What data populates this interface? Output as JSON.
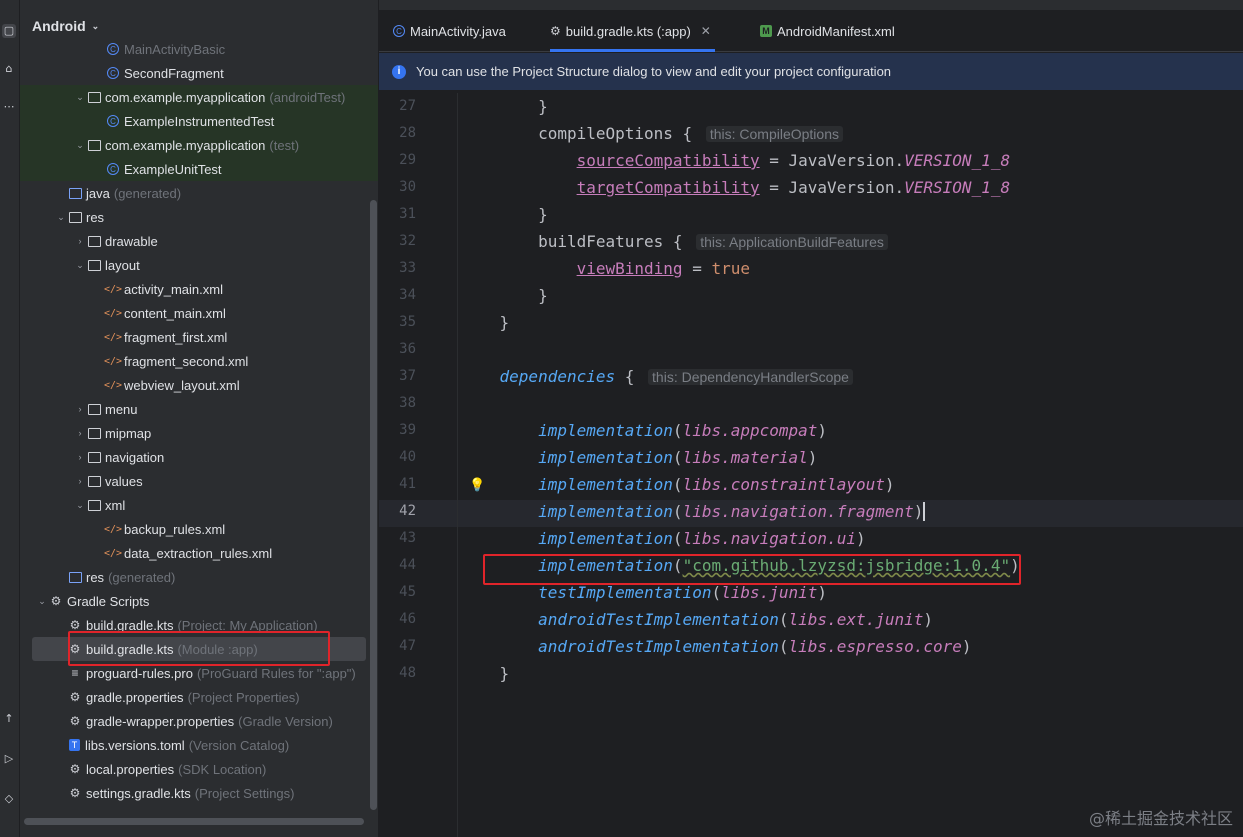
{
  "project_panel": {
    "title": "Android",
    "tree": [
      {
        "label": "MainActivityBasic",
        "hint": "",
        "icon": "class",
        "indent": 3,
        "arrow": ""
      },
      {
        "label": "SecondFragment",
        "hint": "",
        "icon": "class",
        "indent": 3,
        "arrow": ""
      },
      {
        "label": "com.example.myapplication",
        "hint": "(androidTest)",
        "icon": "package",
        "indent": 2,
        "arrow": "down"
      },
      {
        "label": "ExampleInstrumentedTest",
        "hint": "",
        "icon": "class",
        "indent": 3,
        "arrow": ""
      },
      {
        "label": "com.example.myapplication",
        "hint": "(test)",
        "icon": "package",
        "indent": 2,
        "arrow": "down"
      },
      {
        "label": "ExampleUnitTest",
        "hint": "",
        "icon": "class",
        "indent": 3,
        "arrow": ""
      },
      {
        "label": "java",
        "hint": "(generated)",
        "icon": "srcfolder",
        "indent": 1,
        "arrow": ""
      },
      {
        "label": "res",
        "hint": "",
        "icon": "folder",
        "indent": 1,
        "arrow": "down"
      },
      {
        "label": "drawable",
        "hint": "",
        "icon": "folder",
        "indent": 2,
        "arrow": "right"
      },
      {
        "label": "layout",
        "hint": "",
        "icon": "folder",
        "indent": 2,
        "arrow": "down"
      },
      {
        "label": "activity_main.xml",
        "hint": "",
        "icon": "xml",
        "indent": 3,
        "arrow": ""
      },
      {
        "label": "content_main.xml",
        "hint": "",
        "icon": "xml",
        "indent": 3,
        "arrow": ""
      },
      {
        "label": "fragment_first.xml",
        "hint": "",
        "icon": "xml",
        "indent": 3,
        "arrow": ""
      },
      {
        "label": "fragment_second.xml",
        "hint": "",
        "icon": "xml",
        "indent": 3,
        "arrow": ""
      },
      {
        "label": "webview_layout.xml",
        "hint": "",
        "icon": "xml",
        "indent": 3,
        "arrow": ""
      },
      {
        "label": "menu",
        "hint": "",
        "icon": "folder",
        "indent": 2,
        "arrow": "right"
      },
      {
        "label": "mipmap",
        "hint": "",
        "icon": "folder",
        "indent": 2,
        "arrow": "right"
      },
      {
        "label": "navigation",
        "hint": "",
        "icon": "folder",
        "indent": 2,
        "arrow": "right"
      },
      {
        "label": "values",
        "hint": "",
        "icon": "folder",
        "indent": 2,
        "arrow": "right"
      },
      {
        "label": "xml",
        "hint": "",
        "icon": "folder",
        "indent": 2,
        "arrow": "down"
      },
      {
        "label": "backup_rules.xml",
        "hint": "",
        "icon": "xml",
        "indent": 3,
        "arrow": ""
      },
      {
        "label": "data_extraction_rules.xml",
        "hint": "",
        "icon": "xml",
        "indent": 3,
        "arrow": ""
      },
      {
        "label": "res",
        "hint": "(generated)",
        "icon": "srcfolder",
        "indent": 1,
        "arrow": ""
      },
      {
        "label": "Gradle Scripts",
        "hint": "",
        "icon": "gradle",
        "indent": 0,
        "arrow": "down"
      },
      {
        "label": "build.gradle.kts",
        "hint": "(Project: My Application)",
        "icon": "gradle",
        "indent": 1,
        "arrow": ""
      },
      {
        "label": "build.gradle.kts",
        "hint": "(Module :app)",
        "icon": "gradle",
        "indent": 1,
        "arrow": "",
        "selected": true
      },
      {
        "label": "proguard-rules.pro",
        "hint": "(ProGuard Rules for \":app\")",
        "icon": "text",
        "indent": 1,
        "arrow": ""
      },
      {
        "label": "gradle.properties",
        "hint": "(Project Properties)",
        "icon": "settings",
        "indent": 1,
        "arrow": ""
      },
      {
        "label": "gradle-wrapper.properties",
        "hint": "(Gradle Version)",
        "icon": "settings",
        "indent": 1,
        "arrow": ""
      },
      {
        "label": "libs.versions.toml",
        "hint": "(Version Catalog)",
        "icon": "toml",
        "indent": 1,
        "arrow": ""
      },
      {
        "label": "local.properties",
        "hint": "(SDK Location)",
        "icon": "settings",
        "indent": 1,
        "arrow": ""
      },
      {
        "label": "settings.gradle.kts",
        "hint": "(Project Settings)",
        "icon": "gradle",
        "indent": 1,
        "arrow": ""
      }
    ]
  },
  "tabs": [
    {
      "label": "MainActivity.java",
      "icon": "class"
    },
    {
      "label": "build.gradle.kts (:app)",
      "icon": "gradle",
      "active": true
    },
    {
      "label": "AndroidManifest.xml",
      "icon": "manifest"
    }
  ],
  "banner": {
    "text": "You can use the Project Structure dialog to view and edit your project configuration"
  },
  "code_lines": [
    {
      "n": "27",
      "tokens": [
        {
          "t": "        }"
        }
      ]
    },
    {
      "n": "28",
      "tokens": [
        {
          "t": "        compileOptions { "
        },
        {
          "t": "this: CompileOptions",
          "c": "inlay"
        }
      ]
    },
    {
      "n": "29",
      "tokens": [
        {
          "t": "            "
        },
        {
          "t": "sourceCompatibility",
          "c": "prop"
        },
        {
          "t": " = JavaVersion."
        },
        {
          "t": "VERSION_1_8",
          "c": "st"
        }
      ]
    },
    {
      "n": "30",
      "tokens": [
        {
          "t": "            "
        },
        {
          "t": "targetCompatibility",
          "c": "prop"
        },
        {
          "t": " = JavaVersion."
        },
        {
          "t": "VERSION_1_8",
          "c": "st"
        }
      ]
    },
    {
      "n": "31",
      "tokens": [
        {
          "t": "        }"
        }
      ]
    },
    {
      "n": "32",
      "tokens": [
        {
          "t": "        buildFeatures { "
        },
        {
          "t": "this: ApplicationBuildFeatures",
          "c": "inlay"
        }
      ]
    },
    {
      "n": "33",
      "tokens": [
        {
          "t": "            "
        },
        {
          "t": "viewBinding",
          "c": "prop"
        },
        {
          "t": " = "
        },
        {
          "t": "true",
          "c": "kw"
        }
      ]
    },
    {
      "n": "34",
      "tokens": [
        {
          "t": "        }"
        }
      ]
    },
    {
      "n": "35",
      "tokens": [
        {
          "t": "    }"
        }
      ]
    },
    {
      "n": "36",
      "tokens": [
        {
          "t": ""
        }
      ]
    },
    {
      "n": "37",
      "tokens": [
        {
          "t": "    "
        },
        {
          "t": "dependencies",
          "c": "fn"
        },
        {
          "t": " { "
        },
        {
          "t": "this: DependencyHandlerScope",
          "c": "inlay"
        }
      ]
    },
    {
      "n": "38",
      "tokens": [
        {
          "t": ""
        }
      ]
    },
    {
      "n": "39",
      "tokens": [
        {
          "t": "        "
        },
        {
          "t": "implementation",
          "c": "fn"
        },
        {
          "t": "("
        },
        {
          "t": "libs.appcompat",
          "c": "lib"
        },
        {
          "t": ")"
        }
      ]
    },
    {
      "n": "40",
      "tokens": [
        {
          "t": "        "
        },
        {
          "t": "implementation",
          "c": "fn"
        },
        {
          "t": "("
        },
        {
          "t": "libs.material",
          "c": "lib"
        },
        {
          "t": ")"
        }
      ]
    },
    {
      "n": "41",
      "tokens": [
        {
          "t": "        "
        },
        {
          "t": "implementation",
          "c": "fn"
        },
        {
          "t": "("
        },
        {
          "t": "libs.constraintlayout",
          "c": "lib"
        },
        {
          "t": ")"
        }
      ]
    },
    {
      "n": "42",
      "tokens": [
        {
          "t": "        "
        },
        {
          "t": "implementation",
          "c": "fn"
        },
        {
          "t": "("
        },
        {
          "t": "libs.navigation.fragment",
          "c": "lib"
        },
        {
          "t": ")",
          "c": "caret"
        }
      ]
    },
    {
      "n": "43",
      "tokens": [
        {
          "t": "        "
        },
        {
          "t": "implementation",
          "c": "fn"
        },
        {
          "t": "("
        },
        {
          "t": "libs.navigation.ui",
          "c": "lib"
        },
        {
          "t": ")"
        }
      ]
    },
    {
      "n": "44",
      "tokens": [
        {
          "t": "        "
        },
        {
          "t": "implementation",
          "c": "fn"
        },
        {
          "t": "("
        },
        {
          "t": "\"com.github.lzyzsd:jsbridge:1.0.4\"",
          "c": "str squig"
        },
        {
          "t": ")"
        }
      ]
    },
    {
      "n": "45",
      "tokens": [
        {
          "t": "        "
        },
        {
          "t": "testImplementation",
          "c": "fn"
        },
        {
          "t": "("
        },
        {
          "t": "libs.junit",
          "c": "lib"
        },
        {
          "t": ")"
        }
      ]
    },
    {
      "n": "46",
      "tokens": [
        {
          "t": "        "
        },
        {
          "t": "androidTestImplementation",
          "c": "fn"
        },
        {
          "t": "("
        },
        {
          "t": "libs.ext.junit",
          "c": "lib"
        },
        {
          "t": ")"
        }
      ]
    },
    {
      "n": "47",
      "tokens": [
        {
          "t": "        "
        },
        {
          "t": "androidTestImplementation",
          "c": "fn"
        },
        {
          "t": "("
        },
        {
          "t": "libs.espresso.core",
          "c": "lib"
        },
        {
          "t": ")"
        }
      ]
    },
    {
      "n": "48",
      "tokens": [
        {
          "t": "    }"
        }
      ]
    }
  ],
  "current_line": "42",
  "watermark": "@稀土掘金技术社区",
  "colors": {
    "accent": "#3574f0",
    "highlight_box": "#e0242a",
    "string": "#6aab73",
    "function": "#56a8f5",
    "property": "#c77dbb"
  }
}
